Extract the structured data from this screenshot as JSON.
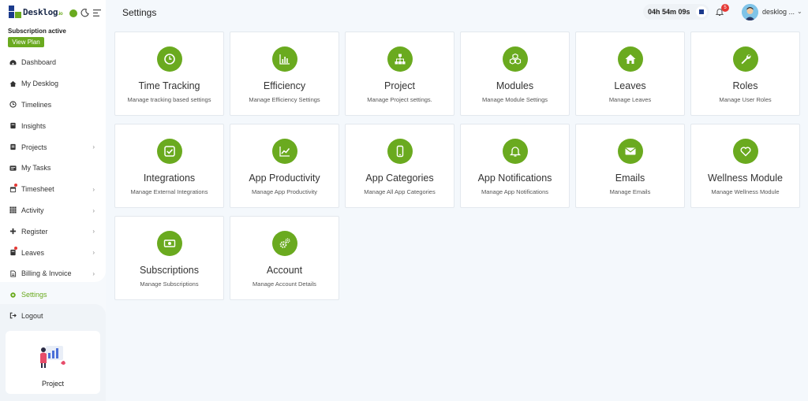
{
  "sidebar": {
    "logo": {
      "brand": "Desklog",
      "suffix": ".io"
    },
    "subscription_status": "Subscription active",
    "view_plan_label": "View Plan",
    "items": [
      {
        "label": "Dashboard",
        "icon": "dashboard-icon",
        "chevron": false
      },
      {
        "label": "My Desklog",
        "icon": "home-icon",
        "chevron": false
      },
      {
        "label": "Timelines",
        "icon": "clock-icon",
        "chevron": false
      },
      {
        "label": "Insights",
        "icon": "book-icon",
        "chevron": false
      },
      {
        "label": "Projects",
        "icon": "folder-icon",
        "chevron": true
      },
      {
        "label": "My Tasks",
        "icon": "tasks-icon",
        "chevron": false
      },
      {
        "label": "Timesheet",
        "icon": "calendar-icon",
        "chevron": true
      },
      {
        "label": "Activity",
        "icon": "grid-icon",
        "chevron": true
      },
      {
        "label": "Register",
        "icon": "plus-icon",
        "chevron": true
      },
      {
        "label": "Leaves",
        "icon": "leaves-icon",
        "chevron": true
      },
      {
        "label": "Billing & Invoice",
        "icon": "invoice-icon",
        "chevron": true
      },
      {
        "label": "Settings",
        "icon": "gear-icon",
        "chevron": false,
        "active": true
      },
      {
        "label": "Logout",
        "icon": "logout-icon",
        "chevron": false
      }
    ],
    "project_card_label": "Project"
  },
  "header": {
    "page_title": "Settings",
    "timer": "04h 54m 09s",
    "notification_count": "5",
    "user_name": "desklog ..."
  },
  "cards": [
    {
      "title": "Time Tracking",
      "desc": "Manage tracking based settings",
      "icon": "clock-icon"
    },
    {
      "title": "Efficiency",
      "desc": "Manage Efficiency Settings",
      "icon": "bar-chart-icon"
    },
    {
      "title": "Project",
      "desc": "Manage Project settings.",
      "icon": "sitemap-icon"
    },
    {
      "title": "Modules",
      "desc": "Manage Module Settings",
      "icon": "cubes-icon"
    },
    {
      "title": "Leaves",
      "desc": "Manage Leaves",
      "icon": "home-icon"
    },
    {
      "title": "Roles",
      "desc": "Manage User Roles",
      "icon": "wrench-icon"
    },
    {
      "title": "Integrations",
      "desc": "Manage External Integrations",
      "icon": "check-square-icon"
    },
    {
      "title": "App Productivity",
      "desc": "Manage App Productivity",
      "icon": "trend-chart-icon"
    },
    {
      "title": "App Categories",
      "desc": "Manage All App Categories",
      "icon": "mobile-icon"
    },
    {
      "title": "App Notifications",
      "desc": "Manage App Notifications",
      "icon": "bell-icon"
    },
    {
      "title": "Emails",
      "desc": "Manage Emails",
      "icon": "envelope-icon"
    },
    {
      "title": "Wellness Module",
      "desc": "Manage Wellness Module",
      "icon": "heart-icon"
    },
    {
      "title": "Subscriptions",
      "desc": "Manage Subscriptions",
      "icon": "money-icon"
    },
    {
      "title": "Account",
      "desc": "Manage Account Details",
      "icon": "cogs-icon"
    }
  ],
  "colors": {
    "accent": "#6aaa1f",
    "brand_blue": "#1b3a8c",
    "badge_red": "#e53935"
  }
}
